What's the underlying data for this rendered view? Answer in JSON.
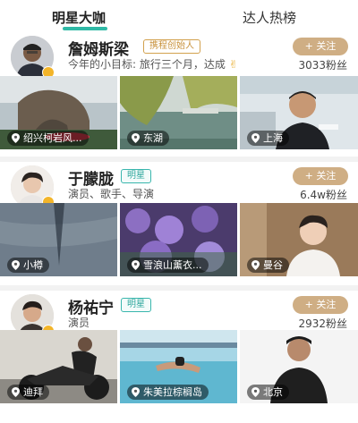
{
  "tabs": [
    {
      "label": "明星大咖",
      "active": true
    },
    {
      "label": "达人热榜",
      "active": false
    }
  ],
  "colors": {
    "accent": "#2fb9a6",
    "follow_button": "#cfae84",
    "vip_badge": "#f3b52a",
    "tag_gold": "#c8923c",
    "tag_teal": "#2fa79d"
  },
  "profiles": [
    {
      "name": "詹姆斯梁",
      "tag": "携程创始人",
      "description": "今年的小目标: 旅行三个月，达成",
      "description_emoji": "✌",
      "follow_label": "+ 关注",
      "fans": "3033粉丝",
      "photos": [
        {
          "location": "绍兴柯岩风...",
          "icon": "location-pin-icon"
        },
        {
          "location": "东湖",
          "icon": "location-pin-icon"
        },
        {
          "location": "上海",
          "icon": "location-pin-icon"
        }
      ]
    },
    {
      "name": "于朦胧",
      "tag": "明星",
      "description": "演员、歌手、导演",
      "follow_label": "+ 关注",
      "fans": "6.4w粉丝",
      "photos": [
        {
          "location": "小樽",
          "icon": "location-pin-icon"
        },
        {
          "location": "雪浪山薰衣...",
          "icon": "location-pin-icon"
        },
        {
          "location": "曼谷",
          "icon": "location-pin-icon"
        }
      ]
    },
    {
      "name": "杨祐宁",
      "tag": "明星",
      "description": "演员",
      "follow_label": "+ 关注",
      "fans": "2932粉丝",
      "photos": [
        {
          "location": "迪拜",
          "icon": "location-pin-icon"
        },
        {
          "location": "朱美拉棕榈岛",
          "icon": "location-pin-icon"
        },
        {
          "location": "北京",
          "icon": "location-pin-icon"
        }
      ]
    }
  ]
}
